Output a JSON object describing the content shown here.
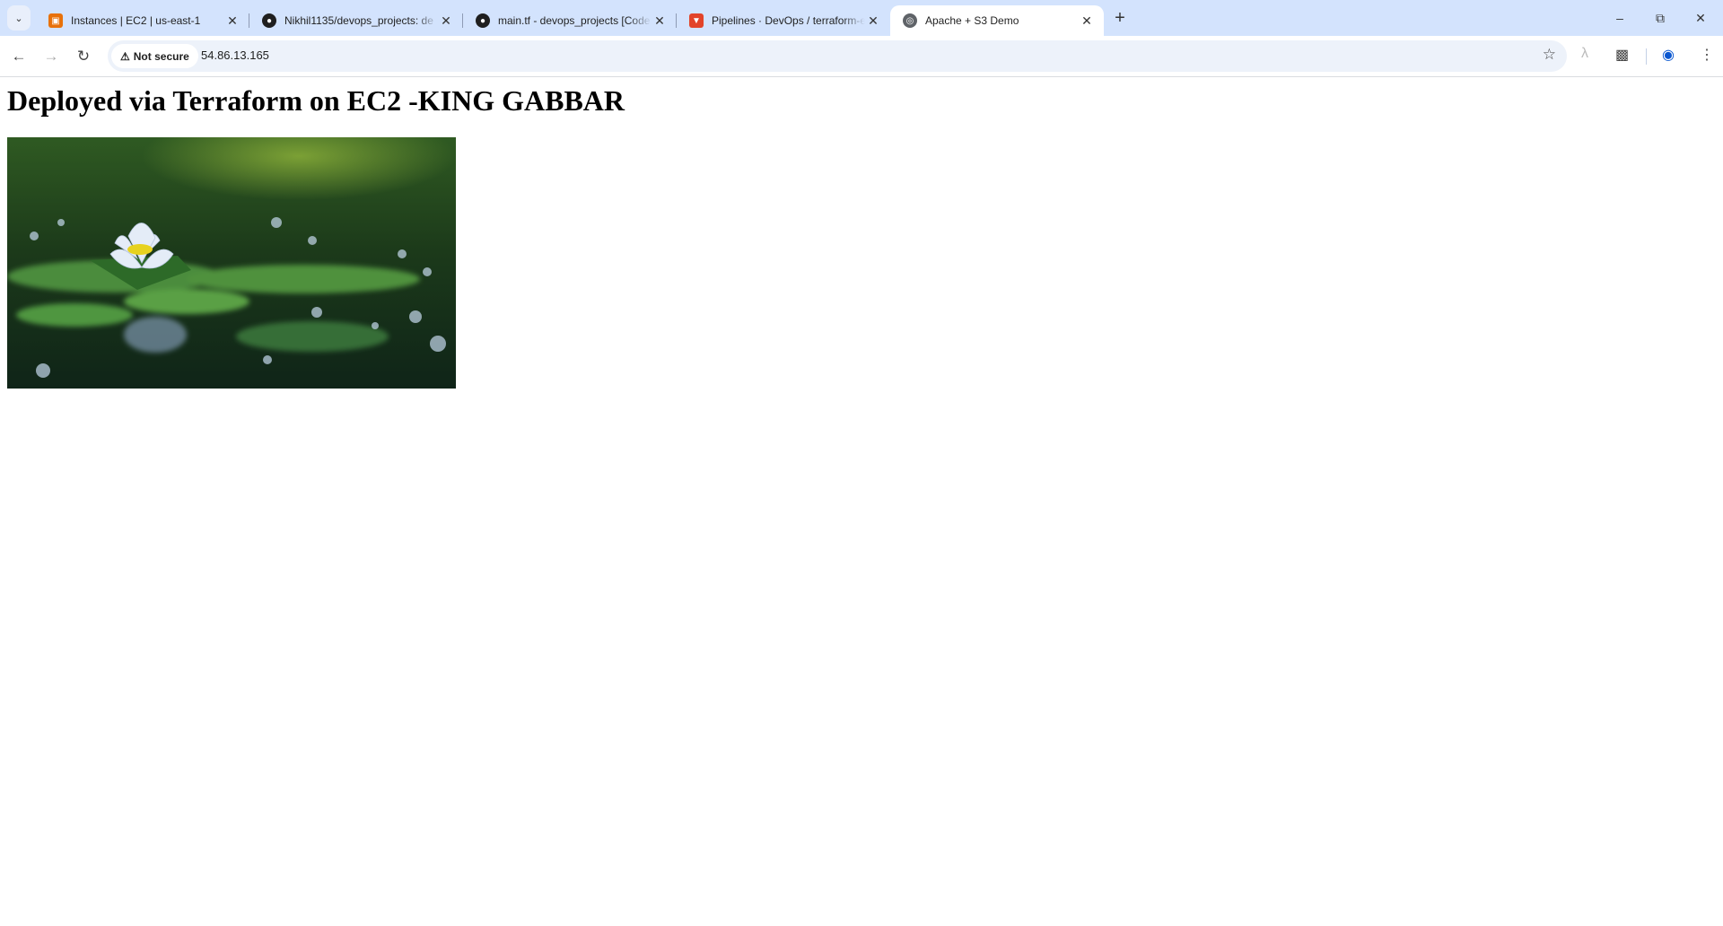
{
  "browser": {
    "tabs": [
      {
        "title": "Instances | EC2 | us-east-1",
        "icon": "aws-ec2-icon",
        "color": "#e8710a"
      },
      {
        "title": "Nikhil1135/devops_projects: de",
        "icon": "github-icon",
        "color": "#1f1f1f"
      },
      {
        "title": "main.tf - devops_projects [Code",
        "icon": "github-icon",
        "color": "#1f1f1f"
      },
      {
        "title": "Pipelines · DevOps / terraform-e",
        "icon": "gitlab-icon",
        "color": "#e24329"
      },
      {
        "title": "Apache + S3 Demo",
        "icon": "globe-icon",
        "color": "#5f6368"
      }
    ],
    "address": {
      "security_label": "Not secure",
      "url": "54.86.13.165"
    }
  },
  "page": {
    "heading": "Deployed via Terraform on EC2 -KING GABBAR"
  }
}
